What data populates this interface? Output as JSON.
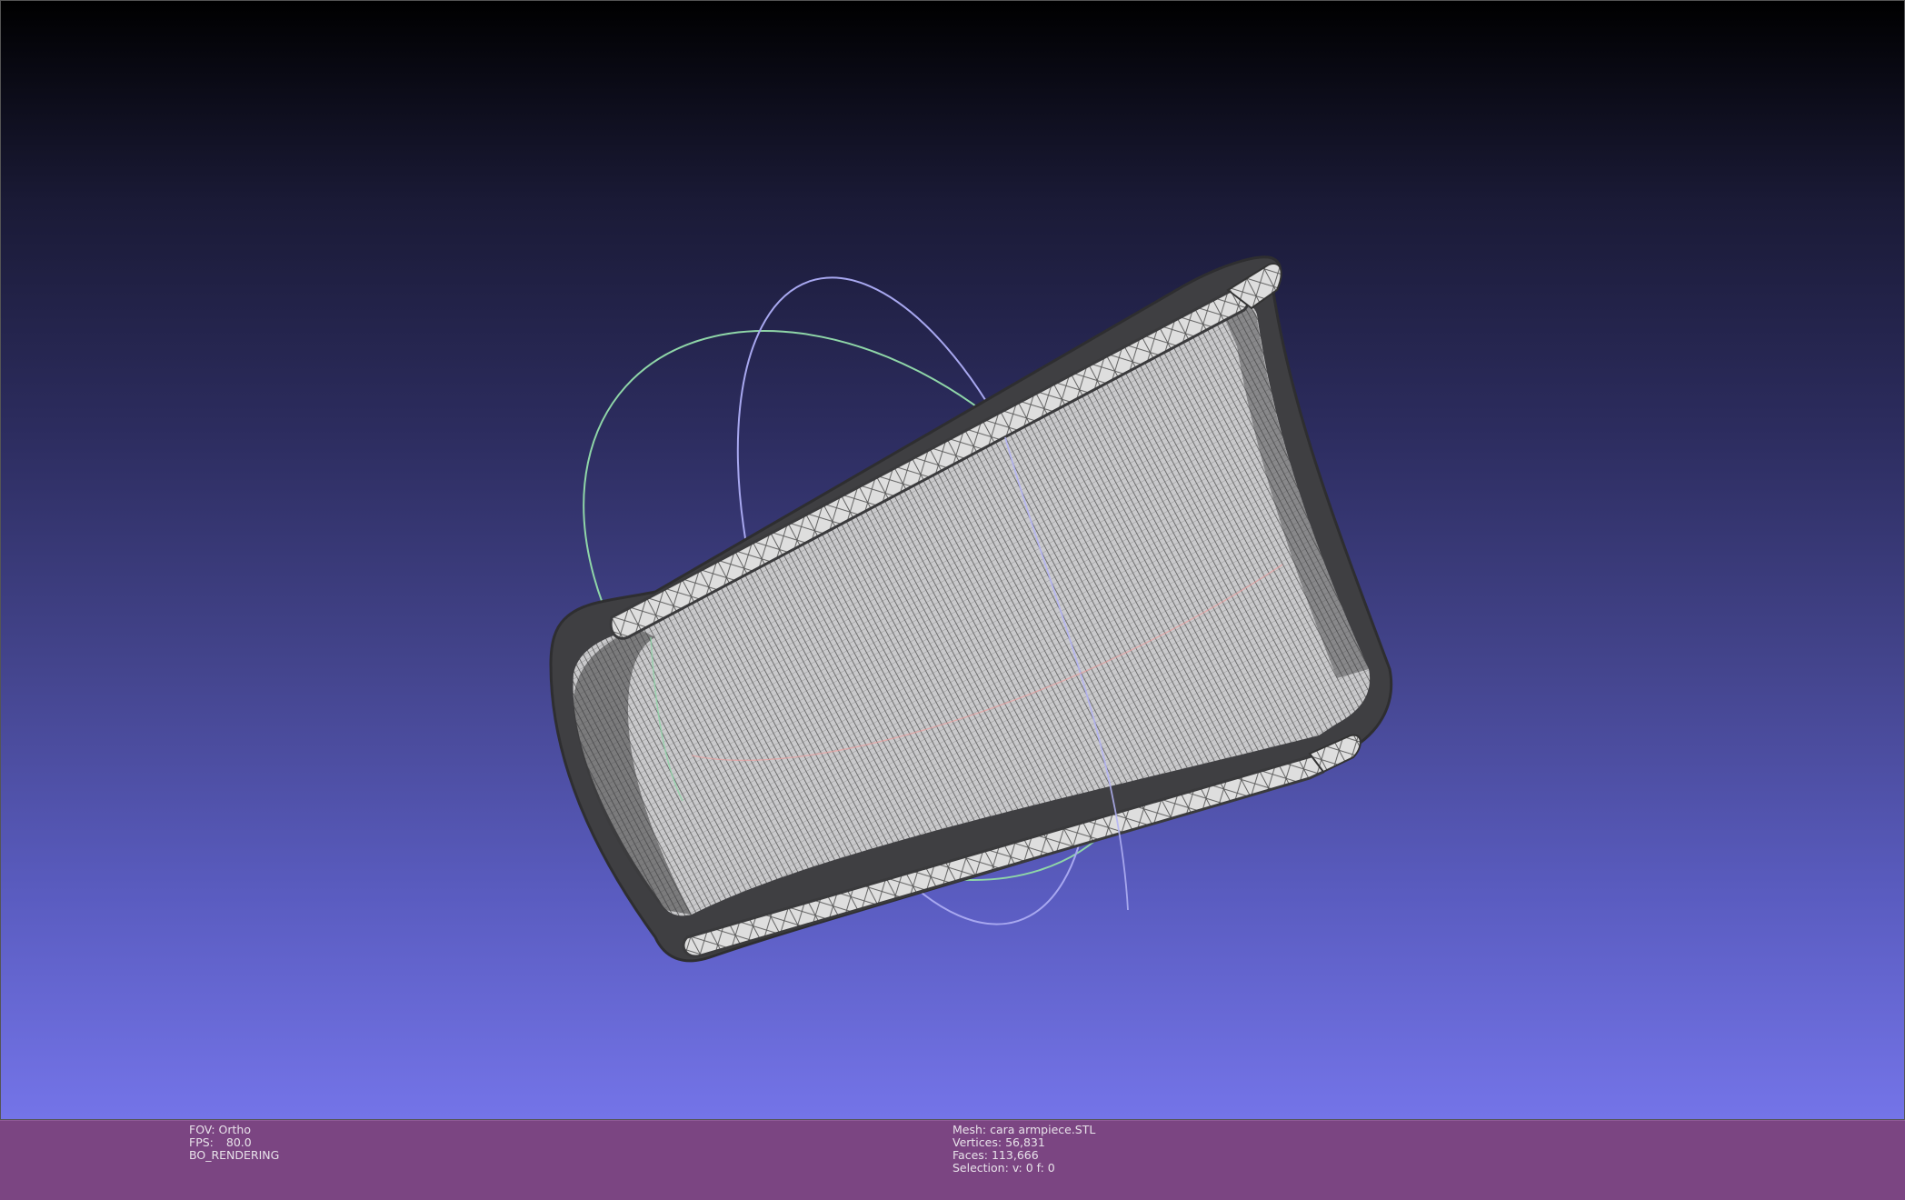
{
  "viewport": {
    "background_top": "#000000",
    "background_bottom": "#7474e8",
    "mesh_color": "#4a4a4a",
    "trackball_colors": {
      "x_axis": "#d88a8a",
      "y_axis": "#8fd6a8",
      "z_axis": "#a8a8f0"
    }
  },
  "info_left": {
    "fov_label": "FOV:",
    "fov_value": "Ortho",
    "fps_label": "FPS:",
    "fps_value": "80.0",
    "render_mode": "BO_RENDERING"
  },
  "info_center": {
    "mesh_label": "Mesh:",
    "mesh_name": "cara armpiece.STL",
    "vertices_label": "Vertices:",
    "vertices_value": "56,831",
    "faces_label": "Faces:",
    "faces_value": "113,666",
    "selection_label": "Selection:",
    "selection_value": "v: 0 f: 0"
  }
}
